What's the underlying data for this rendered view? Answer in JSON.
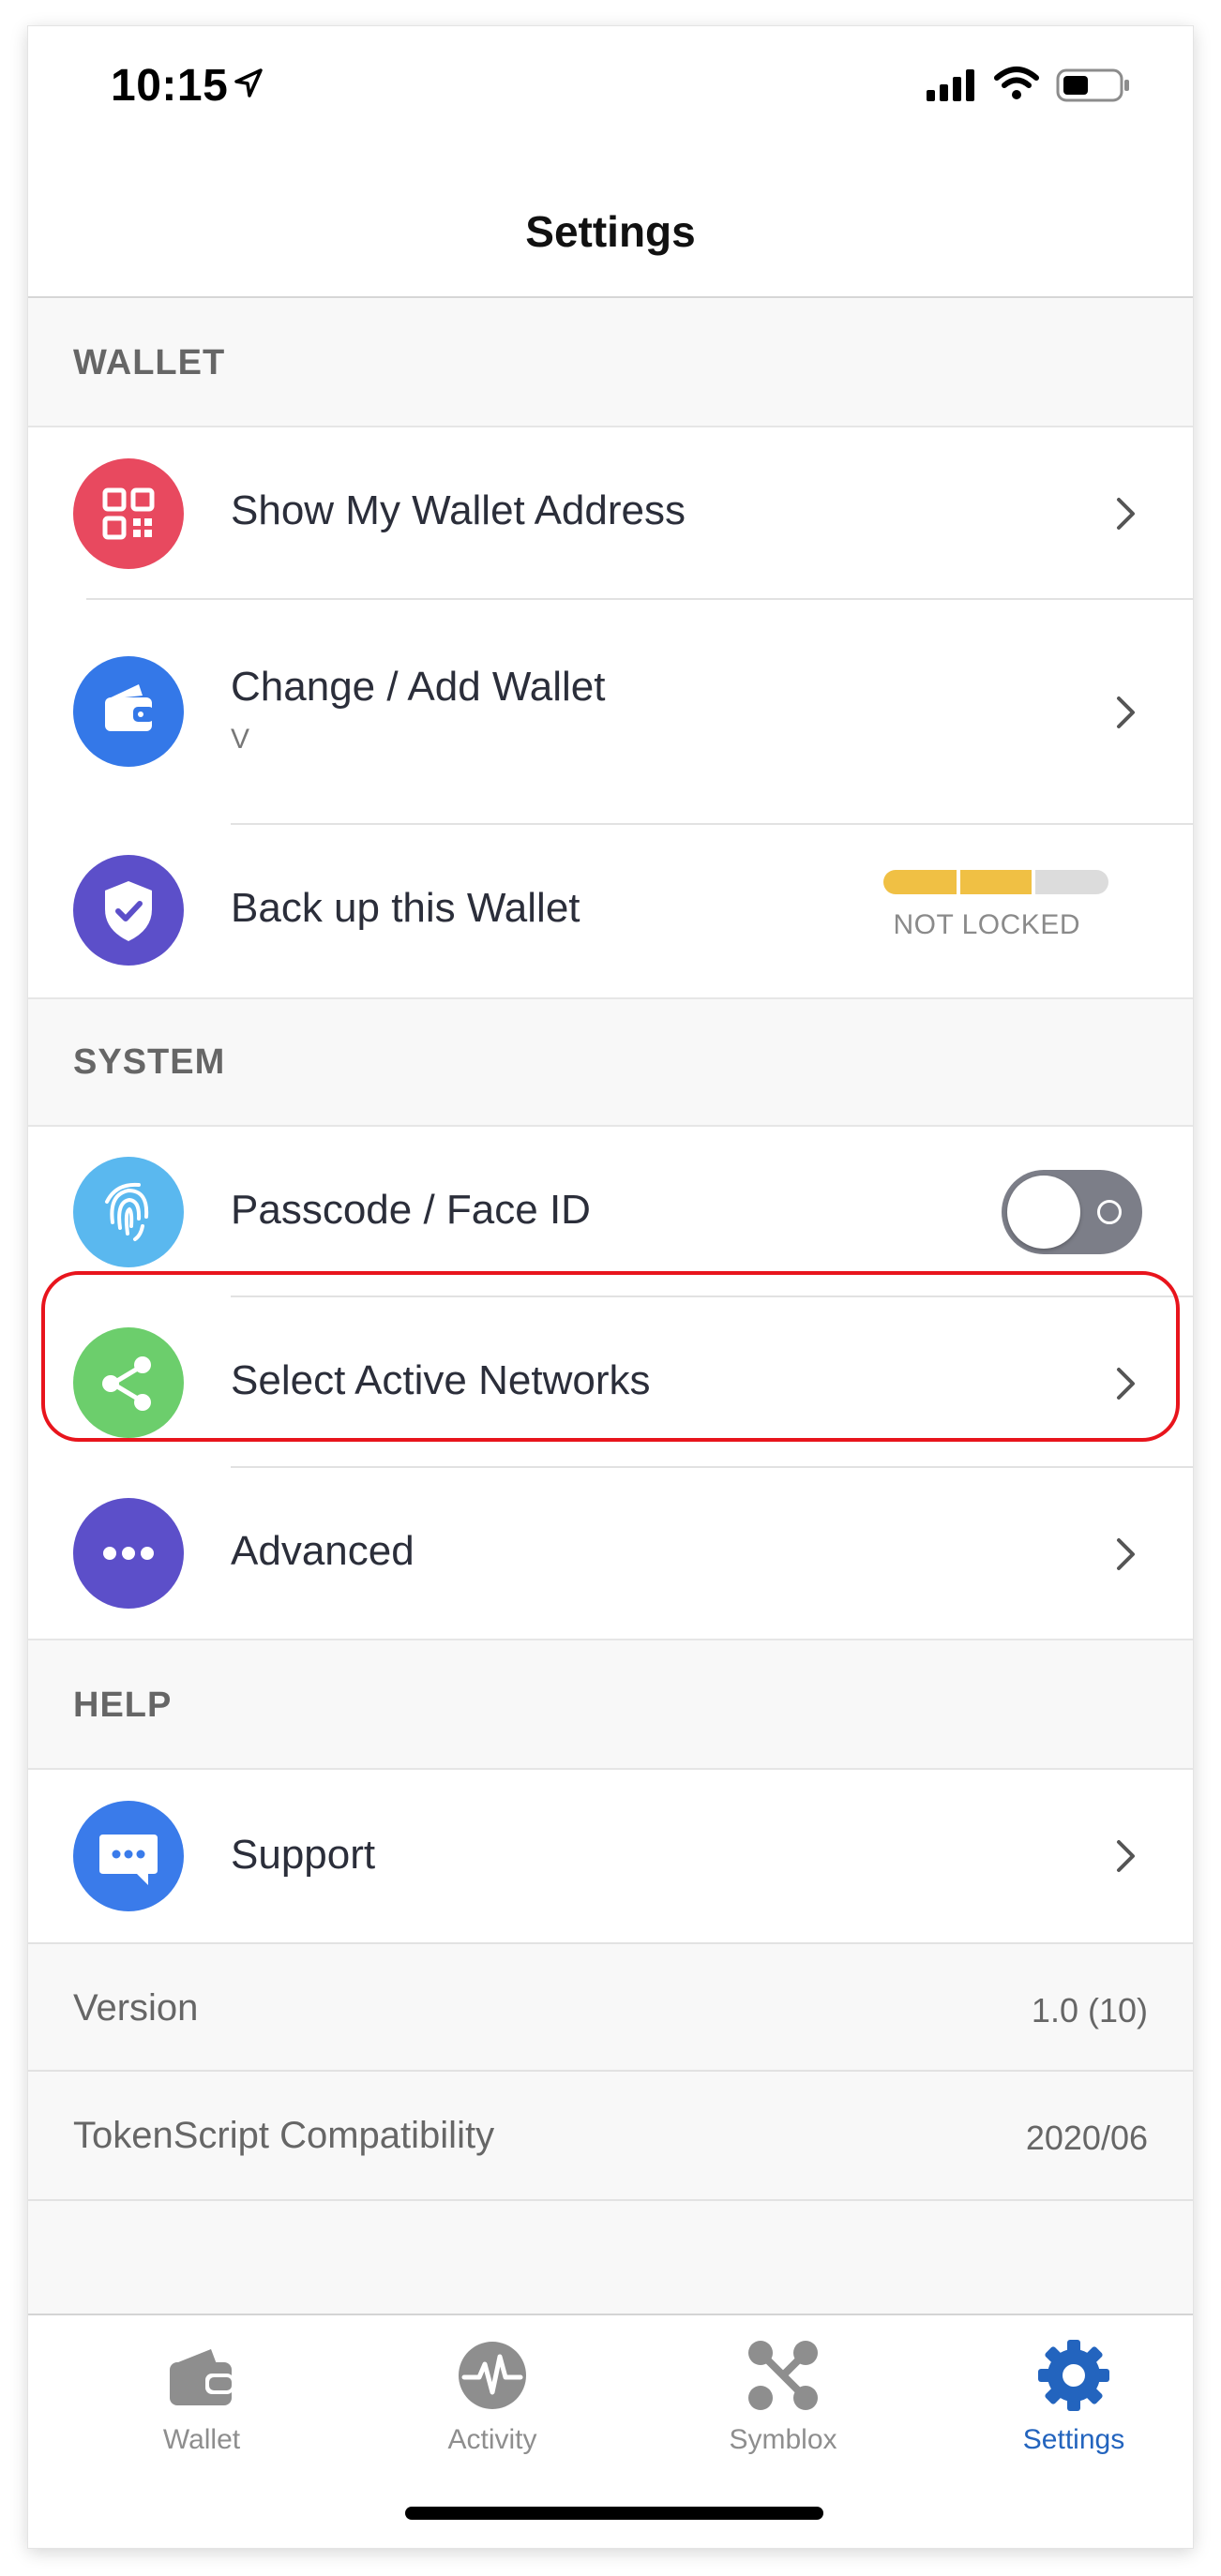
{
  "status": {
    "time": "10:15"
  },
  "nav": {
    "title": "Settings"
  },
  "sections": {
    "wallet": "WALLET",
    "system": "SYSTEM",
    "help": "HELP"
  },
  "rows": {
    "show_address": {
      "label": "Show My Wallet Address",
      "icon": "qr-code-icon",
      "color": "#e8495f"
    },
    "change_wallet": {
      "label": "Change / Add Wallet",
      "sub": "V",
      "icon": "wallet-icon",
      "color": "#3478e8"
    },
    "backup": {
      "label": "Back up this Wallet",
      "icon": "shield-check-icon",
      "color": "#5c4fc9",
      "status": "NOT LOCKED",
      "progress_segments_filled": 2,
      "progress_segments_total": 3
    },
    "passcode": {
      "label": "Passcode / Face ID",
      "icon": "fingerprint-icon",
      "color": "#5ab8ef",
      "toggle_on": false
    },
    "networks": {
      "label": "Select Active Networks",
      "icon": "share-network-icon",
      "color": "#6cce6c"
    },
    "advanced": {
      "label": "Advanced",
      "icon": "more-dots-icon",
      "color": "#5c4fc9"
    },
    "support": {
      "label": "Support",
      "icon": "chat-bubble-icon",
      "color": "#3a7bea"
    }
  },
  "info": {
    "version_key": "Version",
    "version_val": "1.0 (10)",
    "tokenscript_key": "TokenScript Compatibility",
    "tokenscript_val": "2020/06"
  },
  "tabs": [
    {
      "label": "Wallet",
      "icon": "wallet-icon",
      "active": false
    },
    {
      "label": "Activity",
      "icon": "activity-icon",
      "active": false
    },
    {
      "label": "Symblox",
      "icon": "symblox-icon",
      "active": false
    },
    {
      "label": "Settings",
      "icon": "gear-icon",
      "active": true
    }
  ],
  "colors": {
    "accent": "#2364be",
    "highlight": "#e8141c",
    "progress_fill": "#f0c044",
    "progress_empty": "#dcdcdc"
  }
}
